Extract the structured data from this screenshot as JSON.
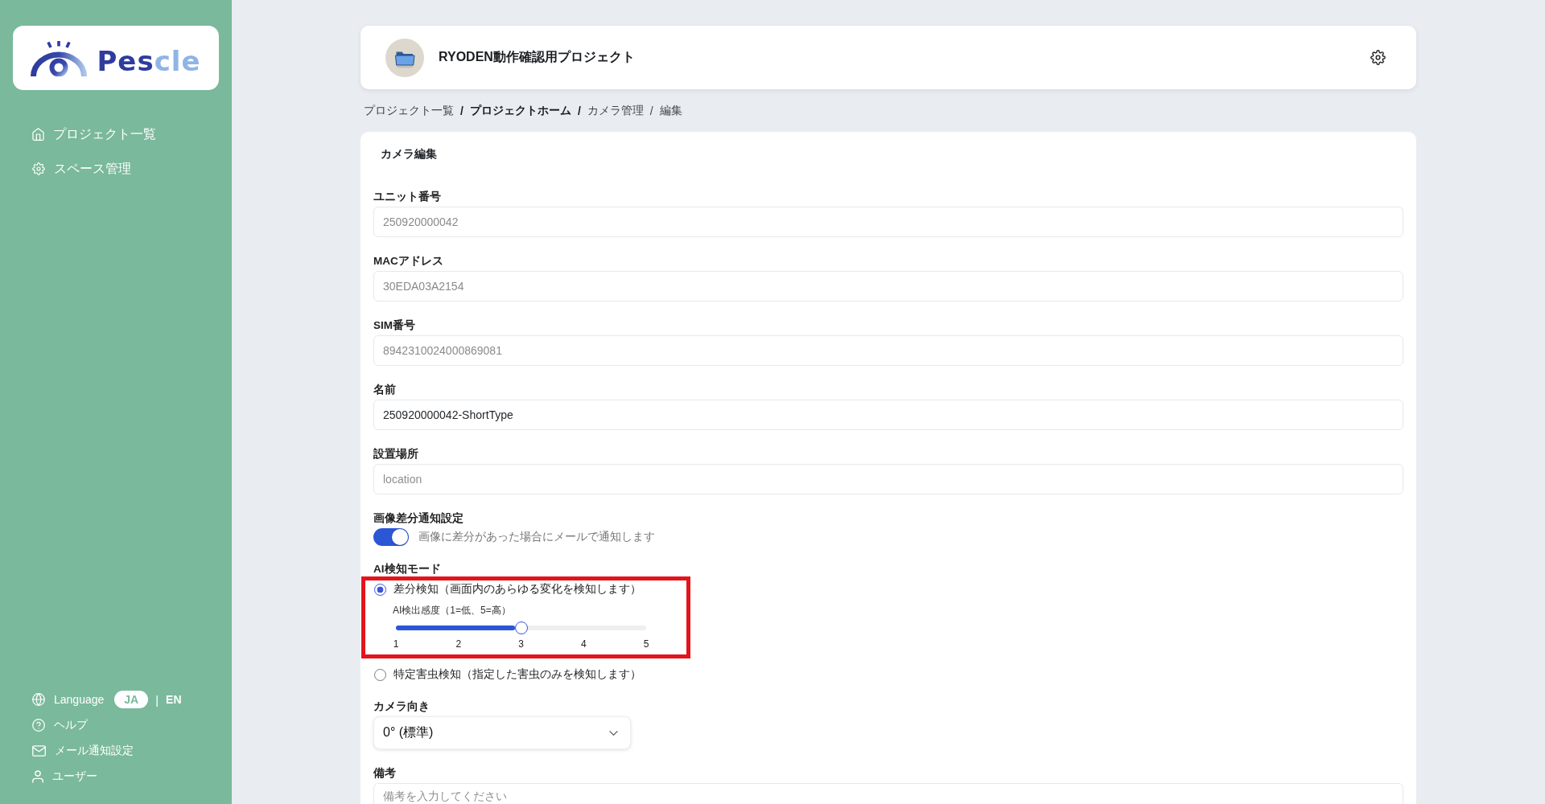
{
  "sidebar": {
    "logo": {
      "parts": [
        {
          "text": "Pes",
          "color": "#2f3c9e"
        },
        {
          "text": "cle",
          "color": "#8fb4e6"
        }
      ]
    },
    "nav": [
      {
        "label": "プロジェクト一覧"
      },
      {
        "label": "スペース管理"
      }
    ],
    "language": {
      "label": "Language",
      "separator": "|",
      "options": [
        {
          "label": "JA",
          "selected": true
        },
        {
          "label": "EN",
          "selected": false
        }
      ]
    },
    "links": [
      {
        "label": "ヘルプ"
      },
      {
        "label": "メール通知設定"
      },
      {
        "label": "ユーザー"
      }
    ]
  },
  "header": {
    "project_name": "RYODEN動作確認用プロジェクト"
  },
  "breadcrumb": {
    "separator": "/",
    "items": [
      {
        "label": "プロジェクト一覧",
        "emphasized": false
      },
      {
        "label": "プロジェクトホーム",
        "emphasized": true
      },
      {
        "label": "カメラ管理",
        "emphasized": false
      },
      {
        "label": "編集",
        "emphasized": false
      }
    ]
  },
  "form": {
    "title": "カメラ編集",
    "fields": [
      {
        "kind": "text",
        "label": "ユニット番号",
        "value": "250920000042",
        "disabled": true
      },
      {
        "kind": "text",
        "label": "MACアドレス",
        "value": "30EDA03A2154",
        "disabled": true
      },
      {
        "kind": "text",
        "label": "SIM番号",
        "value": "8942310024000869081",
        "disabled": true
      },
      {
        "kind": "text",
        "label": "名前",
        "value": "250920000042-ShortType",
        "disabled": false
      },
      {
        "kind": "text",
        "label": "設置場所",
        "placeholder": "location",
        "disabled": false
      },
      {
        "kind": "toggle",
        "label": "画像差分通知設定",
        "on": true,
        "description": "画像に差分があった場合にメールで通知します"
      },
      {
        "kind": "radio_group",
        "label": "AI検知モード",
        "options": [
          {
            "label": "差分検知（画面内のあらゆる変化を検知します）",
            "selected": true,
            "highlighted": true,
            "slider": {
              "label": "AI検出感度（1=低、5=高）",
              "level": 0.5,
              "ticks": [
                "1",
                "2",
                "3",
                "4",
                "5"
              ]
            }
          },
          {
            "label": "特定害虫検知（指定した害虫のみを検知します）",
            "selected": false,
            "highlighted": false
          }
        ]
      },
      {
        "kind": "select",
        "label": "カメラ向き",
        "value": "0° (標準)"
      },
      {
        "kind": "textarea",
        "label": "備考",
        "placeholder": "備考を入力してください"
      }
    ]
  }
}
